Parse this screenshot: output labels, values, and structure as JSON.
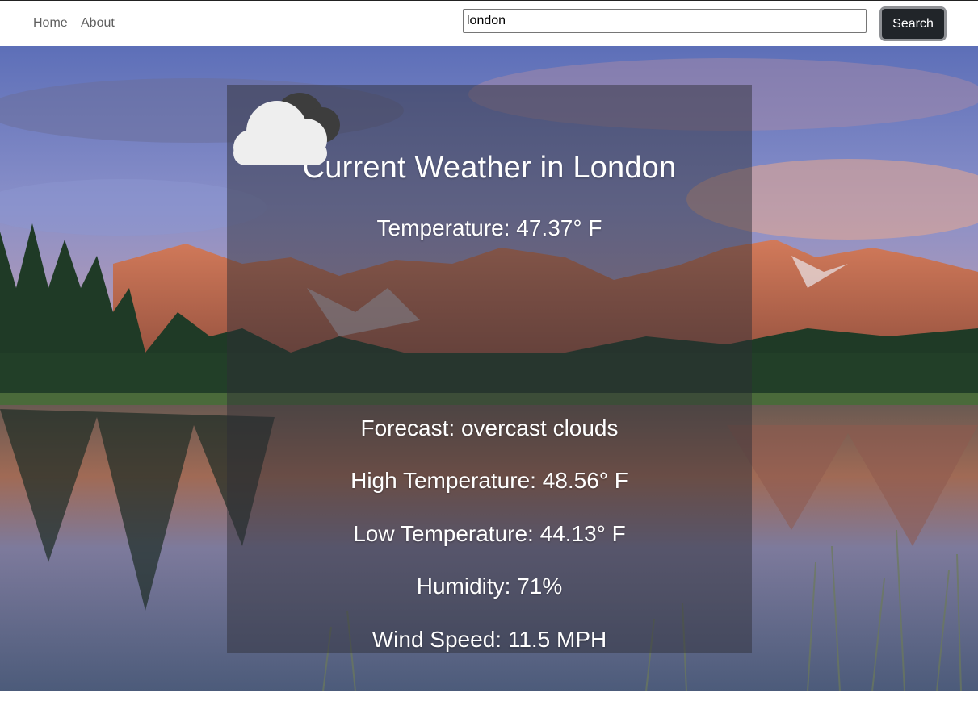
{
  "nav": {
    "links": [
      {
        "label": "Home"
      },
      {
        "label": "About"
      }
    ]
  },
  "search": {
    "value": "london",
    "button_label": "Search"
  },
  "weather": {
    "title": "Current Weather in London",
    "temperature": "Temperature: 47.37° F",
    "icon": "overcast-clouds-icon",
    "forecast": "Forecast: overcast clouds",
    "high": "High Temperature: 48.56° F",
    "low": "Low Temperature: 44.13° F",
    "humidity": "Humidity: 71%",
    "wind": "Wind Speed: 11.5 MPH"
  },
  "colors": {
    "button_bg": "#212529",
    "card_bg": "rgba(45,45,55,0.48)",
    "text": "#ffffff"
  }
}
